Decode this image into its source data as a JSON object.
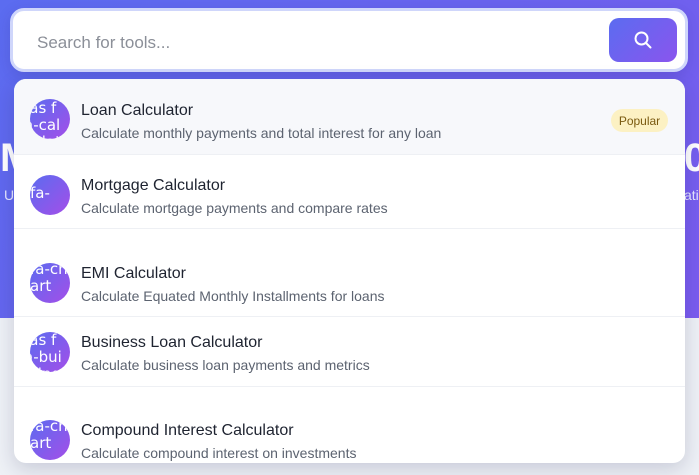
{
  "search": {
    "placeholder": "Search for tools...",
    "button_icon": "search-icon"
  },
  "hero": {
    "title_left_fragment": "M",
    "title_right_fragment": "0",
    "subtitle_left_fragment": "U",
    "subtitle_right_fragment": "ati"
  },
  "results": [
    {
      "icon_text": "fas fa-calculator",
      "title": "Loan Calculator",
      "description": "Calculate monthly payments and total interest for any loan",
      "badge": "Popular"
    },
    {
      "icon_text": "fa-",
      "title": "Mortgage Calculator",
      "description": "Calculate mortgage payments and compare rates"
    },
    {
      "icon_text": "fa-chart",
      "title": "EMI Calculator",
      "description": "Calculate Equated Monthly Installments for loans"
    },
    {
      "icon_text": "fas fa-building",
      "title": "Business Loan Calculator",
      "description": "Calculate business loan payments and metrics"
    },
    {
      "icon_text": "fa-chart",
      "title": "Compound Interest Calculator",
      "description": "Calculate compound interest on investments"
    }
  ],
  "colors": {
    "accent_start": "#5b6cf0",
    "accent_end": "#8a55ee",
    "badge_bg": "#fcf1c3"
  }
}
